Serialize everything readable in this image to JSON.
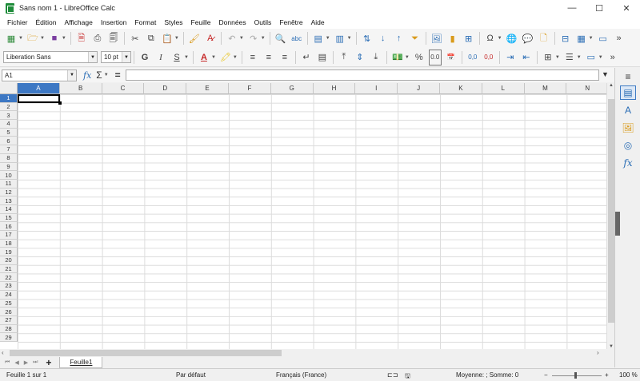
{
  "window": {
    "title": "Sans nom 1 - LibreOffice Calc",
    "controls": {
      "minimize": "—",
      "maximize": "☐",
      "close": "✕"
    }
  },
  "menu": [
    "Fichier",
    "Édition",
    "Affichage",
    "Insertion",
    "Format",
    "Styles",
    "Feuille",
    "Données",
    "Outils",
    "Fenêtre",
    "Aide"
  ],
  "toolbar2": {
    "font_name": "Liberation Sans",
    "font_size": "10 pt",
    "bold": "G",
    "italic": "I",
    "underline": "S",
    "percent": "%",
    "decimal_label": "0.0",
    "add_decimal": "0,0",
    "del_decimal": "0,0"
  },
  "formula_bar": {
    "name_box_value": "A1",
    "fx": "fx",
    "sigma": "Σ",
    "equals": "=",
    "formula_value": ""
  },
  "grid": {
    "columns": [
      "A",
      "B",
      "C",
      "D",
      "E",
      "F",
      "G",
      "H",
      "I",
      "J",
      "K",
      "L",
      "M",
      "N"
    ],
    "rows": [
      "1",
      "2",
      "3",
      "4",
      "5",
      "6",
      "7",
      "8",
      "9",
      "10",
      "11",
      "12",
      "13",
      "14",
      "15",
      "16",
      "17",
      "18",
      "19",
      "20",
      "21",
      "22",
      "23",
      "24",
      "25",
      "26",
      "27",
      "28",
      "29"
    ],
    "selected_cell": "A1"
  },
  "sheets": {
    "tabs": [
      "Feuille1"
    ],
    "add_label": "+"
  },
  "status": {
    "sheet_position": "Feuille 1 sur 1",
    "page_style": "Par défaut",
    "language": "Français (France)",
    "summary": "Moyenne: ; Somme: 0",
    "zoom_out": "−",
    "zoom_in": "+",
    "zoom": "100 %"
  }
}
